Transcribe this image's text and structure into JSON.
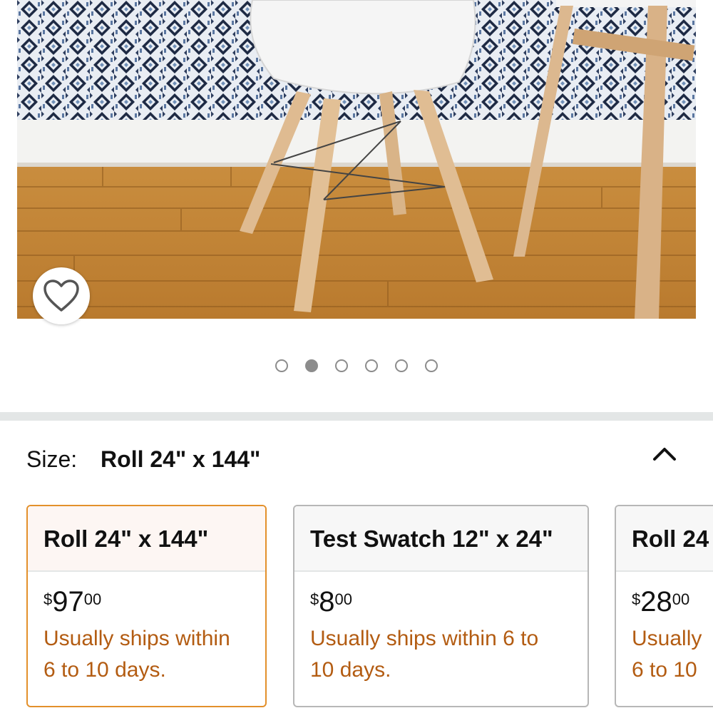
{
  "product_image": {
    "alt": "product photo",
    "wishlist_icon": "heart-outline-icon"
  },
  "carousel": {
    "count": 6,
    "active_index": 1
  },
  "size_selector": {
    "label": "Size:",
    "selected_value": "Roll 24\" x 144\"",
    "toggle_icon": "chevron-up-icon"
  },
  "variants": [
    {
      "title": "Roll 24\" x 144\"",
      "price_symbol": "$",
      "price_whole": "97",
      "price_fraction": "00",
      "shipping_line1": "Usually ships within",
      "shipping_line2": "6 to 10 days.",
      "selected": true
    },
    {
      "title": "Test Swatch 12\" x 24\"",
      "price_symbol": "$",
      "price_whole": "8",
      "price_fraction": "00",
      "shipping_line1": "Usually ships within 6 to",
      "shipping_line2": "10 days.",
      "selected": false
    },
    {
      "title": "Roll 24",
      "price_symbol": "$",
      "price_whole": "28",
      "price_fraction": "00",
      "shipping_line1": "Usually",
      "shipping_line2": "6 to 10",
      "selected": false
    }
  ],
  "colors": {
    "selected_border": "#e3902b",
    "shipping_text": "#b35c12",
    "card_border": "#b7b7b7",
    "divider": "#e3e6e6"
  }
}
